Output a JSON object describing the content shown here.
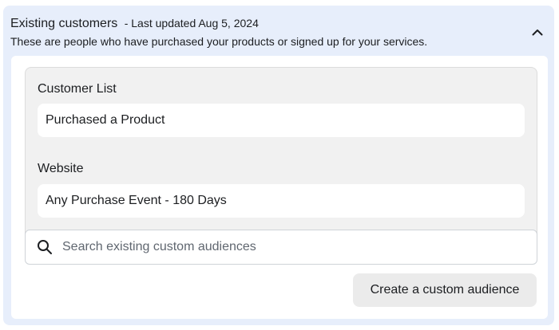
{
  "header": {
    "title": "Existing customers",
    "updated": "- Last updated Aug 5, 2024",
    "subtitle": "These are people who have purchased your products or signed up for your services."
  },
  "groups": [
    {
      "label": "Customer List",
      "items": [
        "Purchased a Product"
      ]
    },
    {
      "label": "Website",
      "items": [
        "Any Purchase Event - 180 Days"
      ]
    }
  ],
  "search": {
    "placeholder": "Search existing custom audiences",
    "value": ""
  },
  "actions": {
    "create_label": "Create a custom audience"
  },
  "icons": {
    "collapse": "chevron-up-icon",
    "search": "search-icon"
  },
  "colors": {
    "panel_bg": "#e7eefb",
    "list_bg": "#f1f1f1",
    "button_bg": "#ebebeb"
  }
}
